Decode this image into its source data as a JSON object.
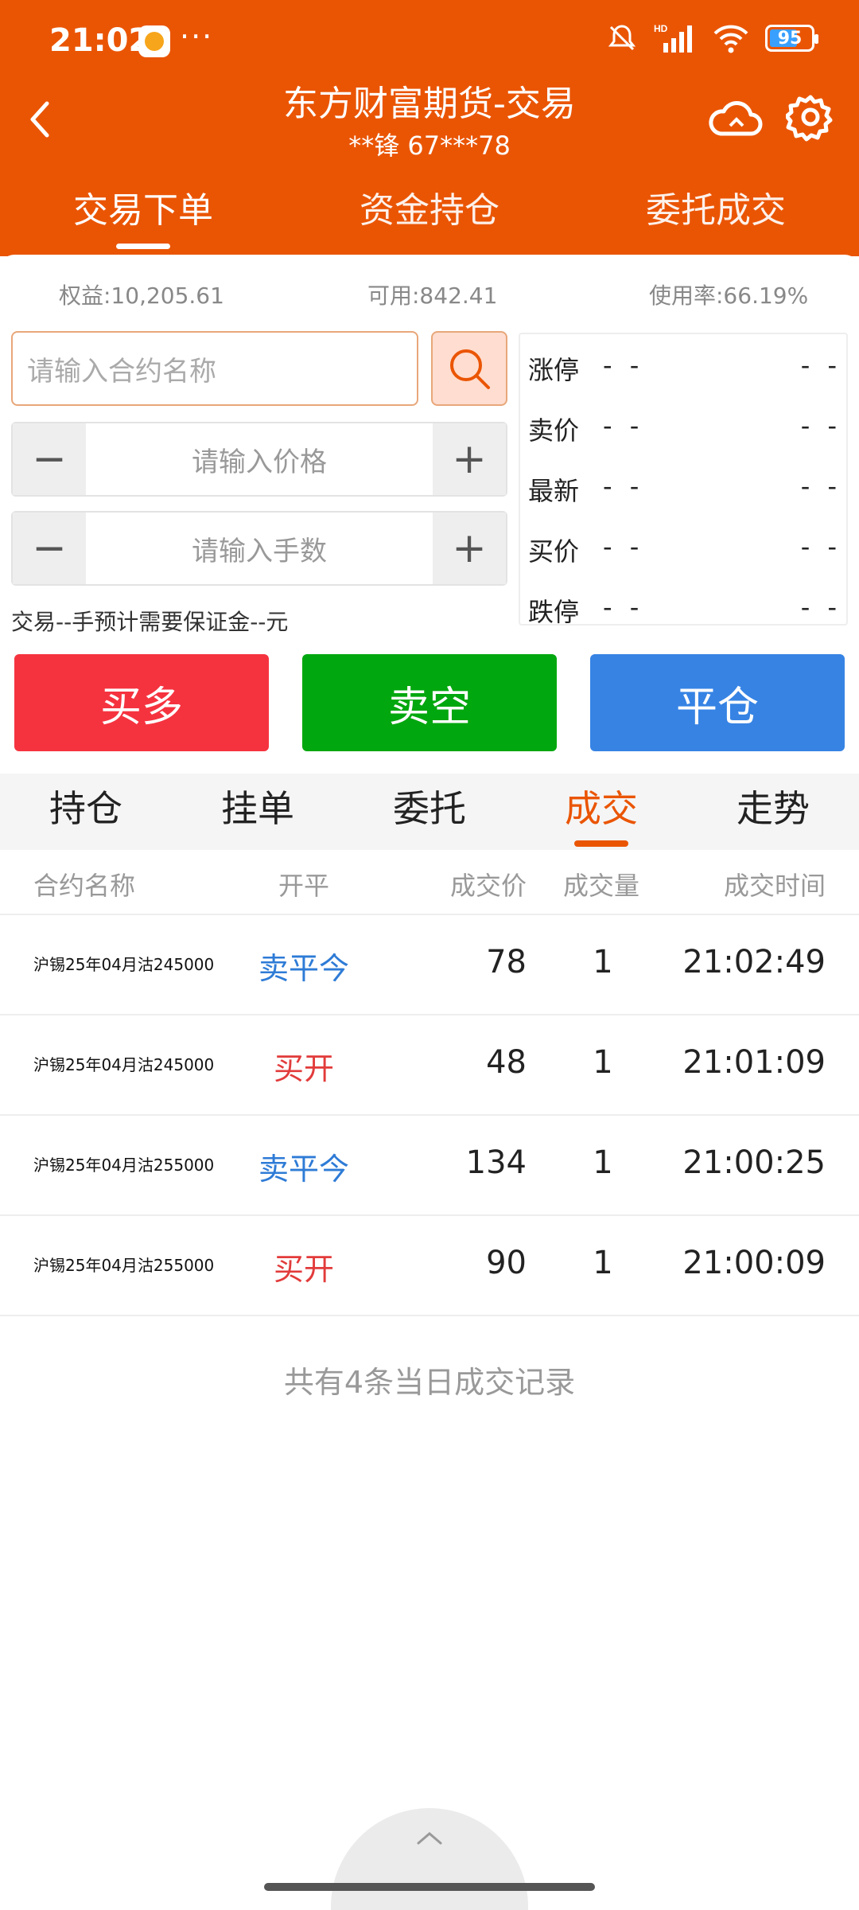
{
  "status_bar": {
    "time": "21:02",
    "more": "···",
    "network": "HD",
    "battery": "95"
  },
  "header": {
    "title": "东方财富期货-交易",
    "subtitle": "**锋  67***78",
    "tabs": [
      {
        "label": "交易下单",
        "active": true
      },
      {
        "label": "资金持仓",
        "active": false
      },
      {
        "label": "委托成交",
        "active": false
      }
    ]
  },
  "account": {
    "equity": "权益:10,205.61",
    "available": "可用:842.41",
    "usage": "使用率:66.19%"
  },
  "order_form": {
    "contract_placeholder": "请输入合约名称",
    "price_placeholder": "请输入价格",
    "quantity_placeholder": "请输入手数",
    "minus": "−",
    "plus": "+",
    "margin_note": "交易--手预计需要保证金--元"
  },
  "quotes": [
    {
      "label": "涨停",
      "value1": "- -",
      "value2": "- -"
    },
    {
      "label": "卖价",
      "value1": "- -",
      "value2": "- -"
    },
    {
      "label": "最新",
      "value1": "- -",
      "value2": "- -"
    },
    {
      "label": "买价",
      "value1": "- -",
      "value2": "- -"
    },
    {
      "label": "跌停",
      "value1": "- -",
      "value2": "- -"
    }
  ],
  "actions": {
    "buy": "买多",
    "sell": "卖空",
    "close": "平仓"
  },
  "sub_tabs": [
    {
      "label": "持仓",
      "active": false
    },
    {
      "label": "挂单",
      "active": false
    },
    {
      "label": "委托",
      "active": false
    },
    {
      "label": "成交",
      "active": true
    },
    {
      "label": "走势",
      "active": false
    }
  ],
  "trades_table": {
    "headers": [
      "合约名称",
      "开平",
      "成交价",
      "成交量",
      "成交时间"
    ],
    "rows": [
      {
        "name": "沪锡25年04月沽245000",
        "type": "卖平今",
        "price": "78",
        "qty": "1",
        "time": "21:02:49",
        "color": "#2E7BD6"
      },
      {
        "name": "沪锡25年04月沽245000",
        "type": "买开",
        "price": "48",
        "qty": "1",
        "time": "21:01:09",
        "color": "#E23B3B"
      },
      {
        "name": "沪锡25年04月沽255000",
        "type": "卖平今",
        "price": "134",
        "qty": "1",
        "time": "21:00:25",
        "color": "#2E7BD6"
      },
      {
        "name": "沪锡25年04月沽255000",
        "type": "买开",
        "price": "90",
        "qty": "1",
        "time": "21:00:09",
        "color": "#E23B3B"
      }
    ],
    "footer": "共有4条当日成交记录"
  },
  "colors": {
    "brand": "#EA5504",
    "buy": "#F5333F",
    "sell": "#00A70E",
    "close": "#3683E4"
  }
}
